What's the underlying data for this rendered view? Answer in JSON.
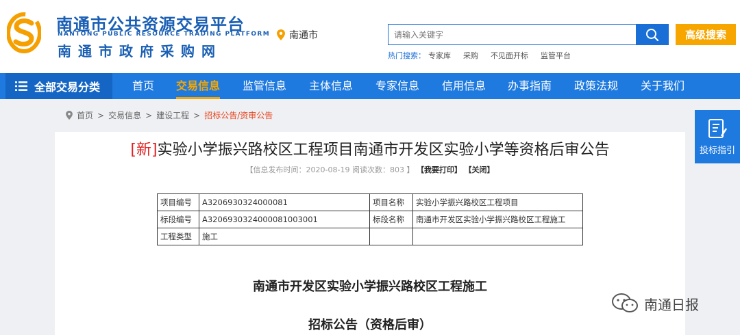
{
  "header": {
    "title": "南通市公共资源交易平台",
    "title_en": "NANTONG PUBLIC RESOURCE TRADING PLATFORM",
    "subtitle": "南通市政府采购网",
    "location": "南通市",
    "search": {
      "placeholder": "请输入关键字"
    },
    "advanced_search_label": "高级搜索",
    "hot_label": "热门搜索：",
    "hot_items": [
      "专家库",
      "采购",
      "不见面开标",
      "监管平台"
    ]
  },
  "nav": {
    "category_label": "全部交易分类",
    "items": [
      "首页",
      "交易信息",
      "监管信息",
      "主体信息",
      "专家信息",
      "信用信息",
      "办事指南",
      "政策法规",
      "关于我们"
    ],
    "active": "交易信息"
  },
  "breadcrumb": [
    "首页",
    "交易信息",
    "建设工程",
    "招标公告/资审公告"
  ],
  "article": {
    "new_tag": "[新]",
    "title": "实验小学振兴路校区工程项目南通市开发区实验小学等资格后审公告",
    "meta": "【信息发布时间：2020-08-19 阅读次数：803 】",
    "print_label": "【我要打印】",
    "close_label": "【关闭】",
    "table": [
      [
        "项目编号",
        "A3206930324000081",
        "项目名称",
        "实验小学振兴路校区工程项目"
      ],
      [
        "标段编号",
        "A3206930324000081003001",
        "标段名称",
        "南通市开发区实验小学振兴路校区工程施工"
      ],
      [
        "工程类型",
        "施工",
        "",
        ""
      ]
    ],
    "heading1": "南通市开发区实验小学振兴路校区工程施工",
    "heading2": "招标公告（资格后审）"
  },
  "side": {
    "guide_label": "投标指引"
  },
  "watermark": "南通日报",
  "colors": {
    "brand_blue": "#1a5fb4",
    "nav_blue": "#1f7ae0",
    "accent_orange": "#f7a600",
    "new_red": "#e02020"
  }
}
